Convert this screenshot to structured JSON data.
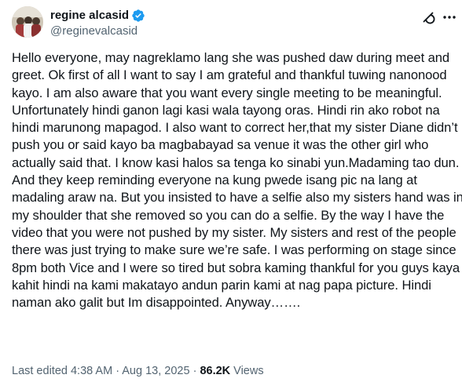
{
  "author": {
    "display_name": "regine alcasid",
    "handle": "@reginevalcasid",
    "verified": true
  },
  "icons": {
    "avatar": "profile-photo",
    "verified": "verified-badge-icon",
    "grok": "grok-icon",
    "more": "more-icon"
  },
  "colors": {
    "verified_blue": "#1d9bf0",
    "text_primary": "#0f1419",
    "text_secondary": "#536471"
  },
  "tweet": {
    "text": "Hello everyone, may nagreklamo lang she was pushed daw during meet and greet. Ok first of all I want to say I am grateful and thankful tuwing nanonood kayo. I am also aware that you want every single meeting to be meaningful. Unfortunately hindi ganon lagi kasi wala tayong oras. Hindi rin ako robot na hindi marunong mapagod. I also want to correct her,that my sister Diane didn’t push you or said kayo ba magbabayad sa venue it was the other girl who actually said that. I know kasi halos sa tenga ko sinabi yun.Madaming tao dun. And they keep reminding everyone na kung pwede isang pic na lang at madaling araw na. But you insisted to have a selfie also my sisters hand was in my shoulder that she removed so you can do a selfie. By the way I have the video that you were not pushed by my sister. My sisters and rest of the people there was just trying to make sure we’re safe. I was performing on stage since 8pm both Vice and I were so tired but sobra kaming thankful for you guys kaya kahit hindi na kami makatayo andun parin kami at nag papa picture. Hindi naman ako galit but Im disappointed. Anyway……."
  },
  "meta": {
    "edited_label": "Last edited 4:38 AM",
    "separator": " · ",
    "date": "Aug 13, 2025",
    "views_count": "86.2K",
    "views_label": " Views"
  }
}
